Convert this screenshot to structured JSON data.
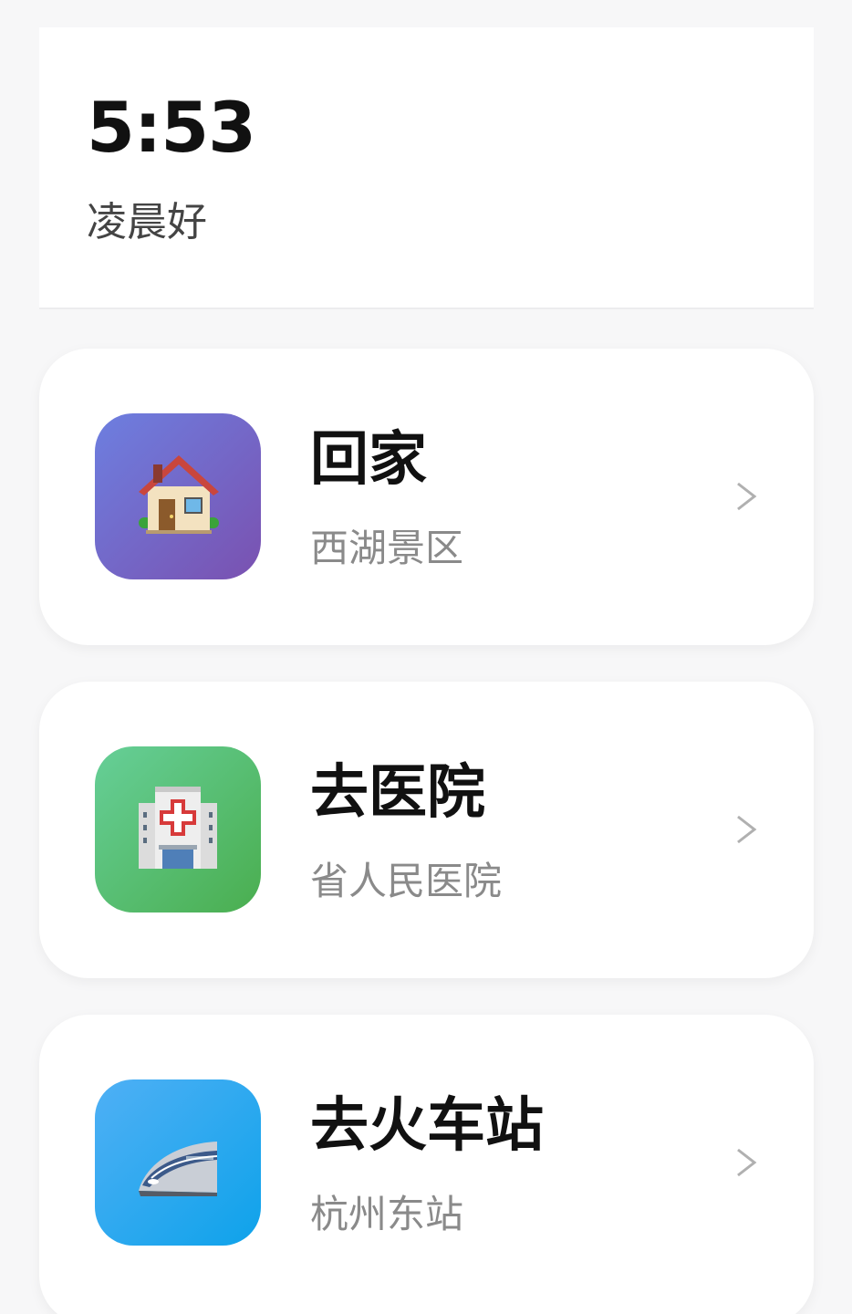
{
  "header": {
    "time": "5:53",
    "greeting": "凌晨好"
  },
  "destinations": [
    {
      "title": "回家",
      "subtitle": "西湖景区",
      "icon": "house-icon",
      "tile_colors": [
        "#6d7fe0",
        "#7a51b0"
      ]
    },
    {
      "title": "去医院",
      "subtitle": "省人民医院",
      "icon": "hospital-icon",
      "tile_colors": [
        "#66cf98",
        "#4aae4f"
      ]
    },
    {
      "title": "去火车站",
      "subtitle": "杭州东站",
      "icon": "high-speed-train-icon",
      "tile_colors": [
        "#4fb0f5",
        "#0ea2ea"
      ]
    }
  ],
  "chevron_icon": "chevron-right-icon"
}
